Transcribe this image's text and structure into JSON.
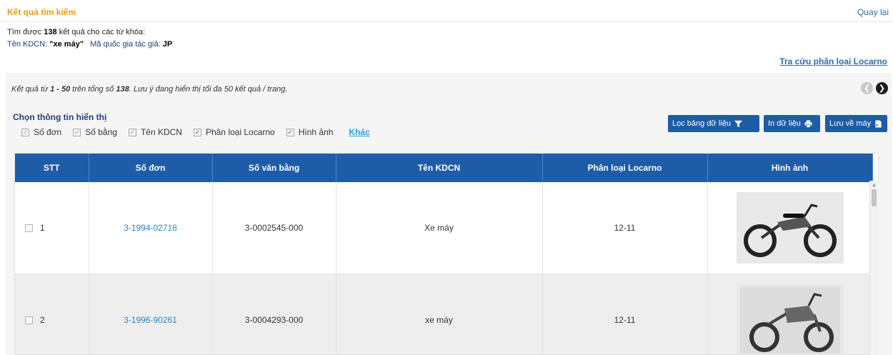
{
  "header": {
    "title": "Kết quả tìm kiếm",
    "back_label": "Quay lại"
  },
  "search_info": {
    "found_prefix": "Tìm được ",
    "found_count": "138",
    "found_suffix": " kết quả cho các từ khóa:",
    "name_label": "Tên KDCN: ",
    "name_value": "\"xe máy\"",
    "country_label": "Mã quốc gia tác giả: ",
    "country_value": "JP"
  },
  "locarno_link": "Tra cứu phân loại Locarno",
  "summary": {
    "p1": "Kết quả từ ",
    "range": "1 - 50",
    "p2": " trên tổng số ",
    "total": "138",
    "p3": ". Lưu ý đang hiển thị tối đa 50 kết quả / trang."
  },
  "display_options": {
    "title": "Chọn thông tin hiển thị",
    "options": [
      {
        "label": "Số đơn",
        "checked": true
      },
      {
        "label": "Số bằng",
        "checked": true
      },
      {
        "label": "Tên KDCN",
        "checked": true
      },
      {
        "label": "Phân loại Locarno",
        "checked": true
      },
      {
        "label": "Hình ảnh",
        "checked": true
      }
    ],
    "other_label": "Khác"
  },
  "buttons": {
    "filter": "Lọc bảng dữ liệu",
    "print": "In dữ liệu",
    "save": "Lưu về máy"
  },
  "table": {
    "columns": [
      "STT",
      "Số đơn",
      "Số văn bằng",
      "Tên KDCN",
      "Phân loại Locarno",
      "Hình ảnh"
    ],
    "rows": [
      {
        "stt": "1",
        "app_no": "3-1994-02718",
        "cert_no": "3-0002545-000",
        "name": "Xe máy",
        "locarno": "12-11"
      },
      {
        "stt": "2",
        "app_no": "3-1996-90261",
        "cert_no": "3-0004293-000",
        "name": "xe máy",
        "locarno": "12-11"
      }
    ]
  },
  "icons": {
    "pager_prev": "chevron-left-icon",
    "pager_next": "chevron-right-icon",
    "filter": "filter-icon",
    "print": "printer-icon",
    "save": "save-file-icon"
  }
}
